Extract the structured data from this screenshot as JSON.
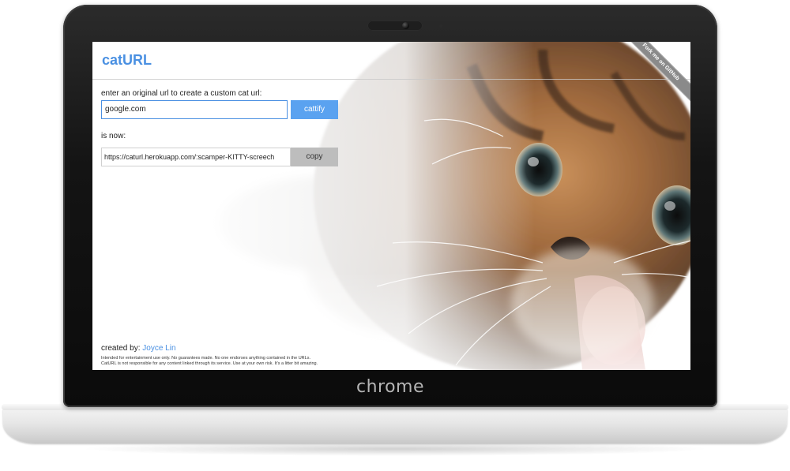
{
  "device": {
    "brand_label": "chrome"
  },
  "app": {
    "logo": "catURL",
    "ribbon": "Fork me on GitHub",
    "form": {
      "prompt": "enter an original url to create a custom cat url:",
      "url_value": "google.com",
      "submit_label": "cattify"
    },
    "result": {
      "label": "is now:",
      "value": "https://caturl.herokuapp.com/:scamper-KITTY-screech",
      "copy_label": "copy"
    },
    "footer": {
      "credit_prefix": "created by:",
      "author": "Joyce Lin",
      "disclaimer_line1": "Intended for entertainment use only. No guarantees made. No one endorses anything contained in the URLs.",
      "disclaimer_line2": "CatURL is not responsible for any content linked through its service. Use at your own risk. It's a litter bit amazing."
    }
  },
  "colors": {
    "accent": "#4a90e2",
    "button_primary": "#5aa2f0",
    "button_secondary": "#bdbdbd",
    "bezel": "#111111"
  },
  "icons": {
    "camera": "webcam-icon",
    "ribbon": "github-ribbon"
  }
}
